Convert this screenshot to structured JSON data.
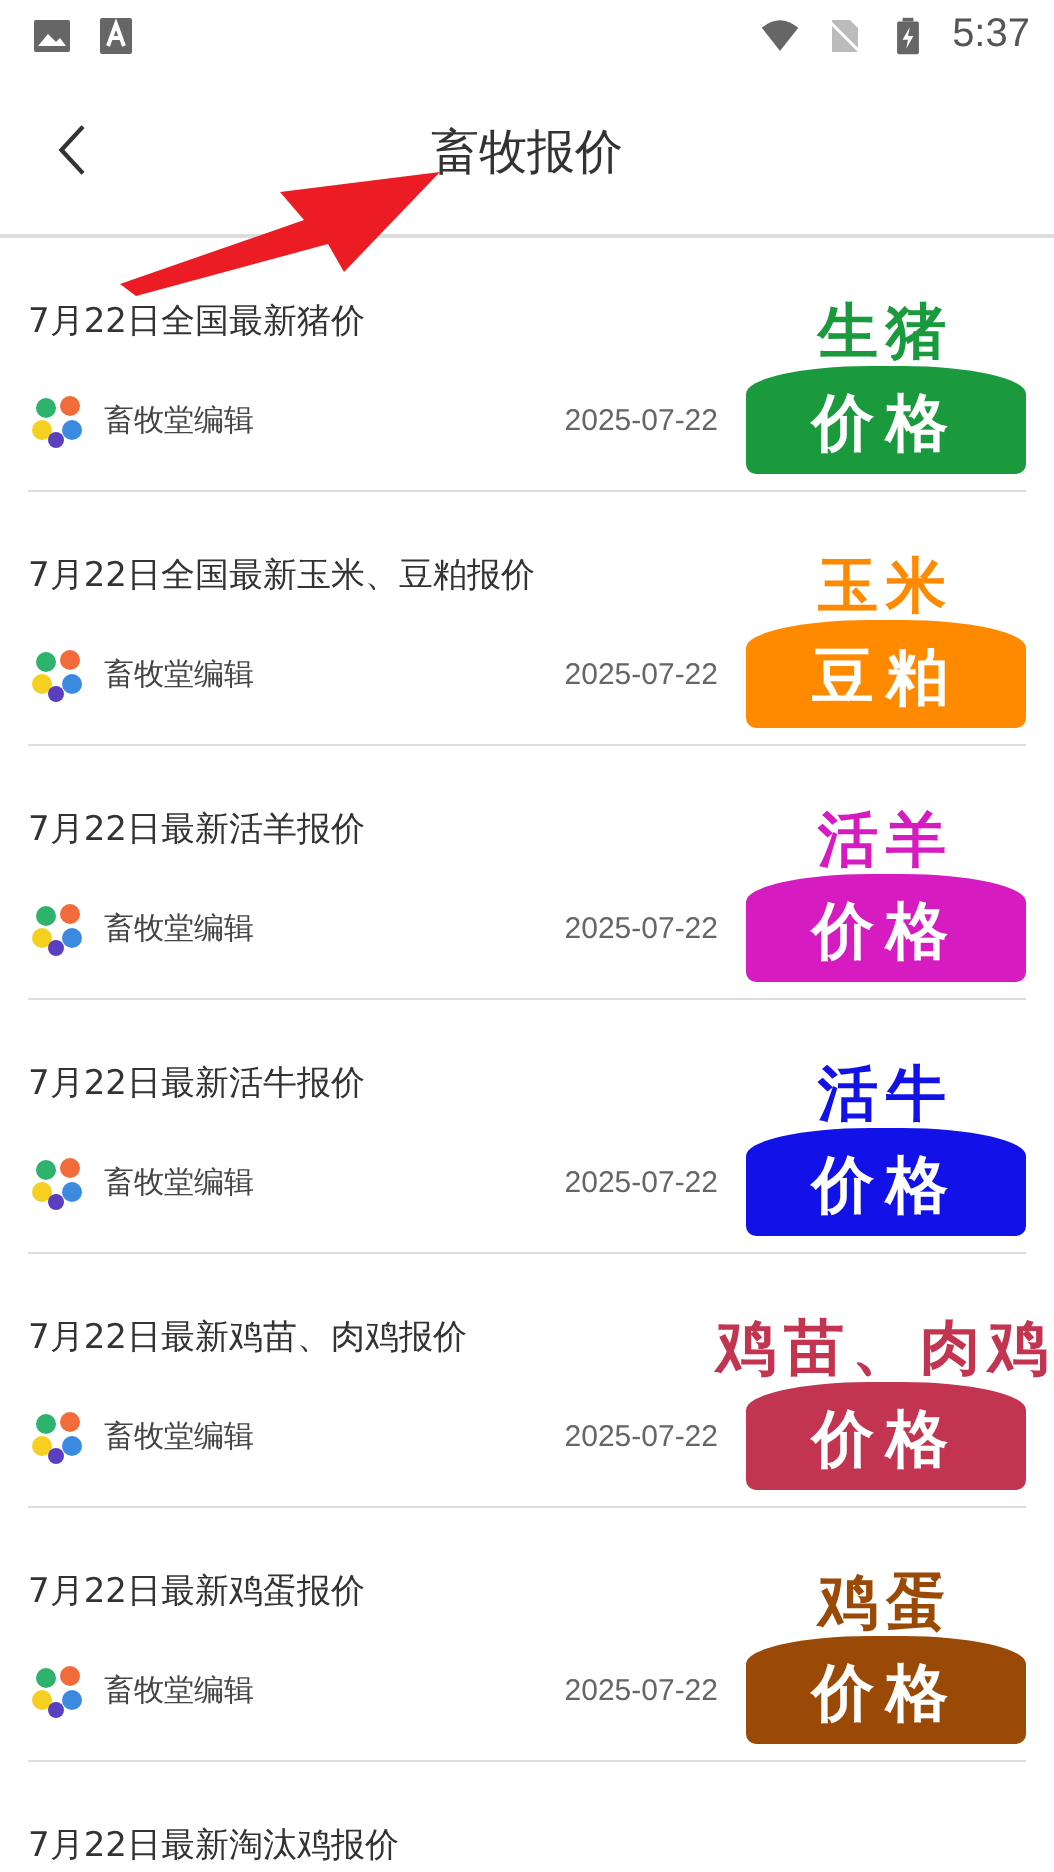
{
  "status_bar": {
    "time": "5:37"
  },
  "toolbar": {
    "title": "畜牧报价"
  },
  "articles": [
    {
      "title": "7月22日全国最新猪价",
      "author": "畜牧堂编辑",
      "date": "2025-07-22",
      "thumb_top": "生猪",
      "thumb_bottom": "价格",
      "color": "#1a9a3c"
    },
    {
      "title": "7月22日全国最新玉米、豆粕报价",
      "author": "畜牧堂编辑",
      "date": "2025-07-22",
      "thumb_top": "玉米",
      "thumb_bottom": "豆粕",
      "color": "#ff8a00"
    },
    {
      "title": "7月22日最新活羊报价",
      "author": "畜牧堂编辑",
      "date": "2025-07-22",
      "thumb_top": "活羊",
      "thumb_bottom": "价格",
      "color": "#d61bc0"
    },
    {
      "title": "7月22日最新活牛报价",
      "author": "畜牧堂编辑",
      "date": "2025-07-22",
      "thumb_top": "活牛",
      "thumb_bottom": "价格",
      "color": "#1212e8"
    },
    {
      "title": "7月22日最新鸡苗、肉鸡报价",
      "author": "畜牧堂编辑",
      "date": "2025-07-22",
      "thumb_top": "鸡苗、肉鸡",
      "thumb_bottom": "价格",
      "color": "#c2344f"
    },
    {
      "title": "7月22日最新鸡蛋报价",
      "author": "畜牧堂编辑",
      "date": "2025-07-22",
      "thumb_top": "鸡蛋",
      "thumb_bottom": "价格",
      "color": "#9a4a06"
    },
    {
      "title": "7月22日最新淘汰鸡报价"
    }
  ]
}
